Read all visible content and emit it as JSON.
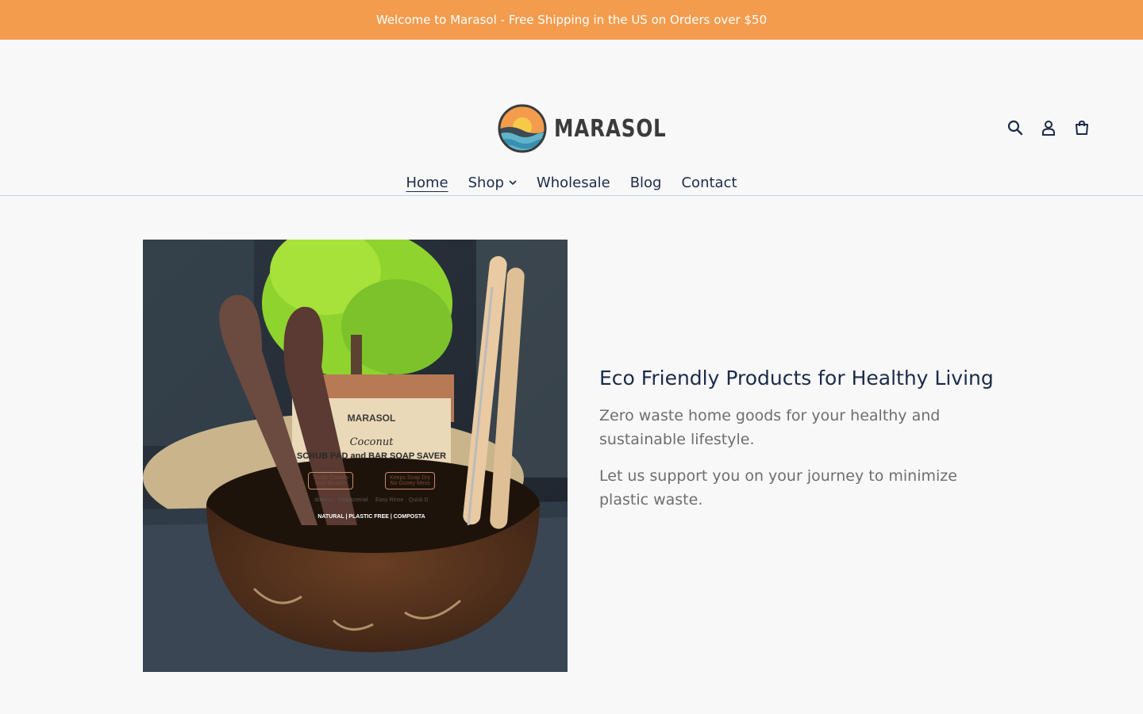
{
  "announcement": "Welcome to Marasol - Free Shipping in the US on Orders over $50",
  "brand": {
    "name": "MARASOL"
  },
  "icons": {
    "search": "search-icon",
    "account": "user-icon",
    "cart": "cart-icon",
    "shop_dropdown": "chevron-down-icon"
  },
  "nav": {
    "home": "Home",
    "shop": "Shop",
    "wholesale": "Wholesale",
    "blog": "Blog",
    "contact": "Contact"
  },
  "hero": {
    "image_alt": "Coconut bowl with wooden spoons, bamboo straws and a Marasol coconut scrub pad",
    "product_box": {
      "brand": "MARASOL",
      "name_script": "Coconut",
      "name": "SCRUB PAD and BAR SOAP SAVER",
      "feature1_line1": "Tough Cleaner",
      "feature1_line2": "Non-Scratch",
      "feature2_line1": "Keeps Soap Dry",
      "feature2_line2": "No Gooey Mess",
      "line3": "dorless · Antibacterial     Easy Rinse · Quick D",
      "band": "NATURAL | PLASTIC FREE | COMPOSTA"
    }
  },
  "intro": {
    "heading": "Eco Friendly Products for Healthy Living",
    "p1": "Zero waste home goods for your healthy and sustainable lifestyle.",
    "p2": "Let us support you on your journey to minimize plastic waste."
  },
  "colors": {
    "announcement_bg": "#f39c4e",
    "text_primary": "#1c2b4a",
    "text_muted": "#6e6e6e"
  }
}
